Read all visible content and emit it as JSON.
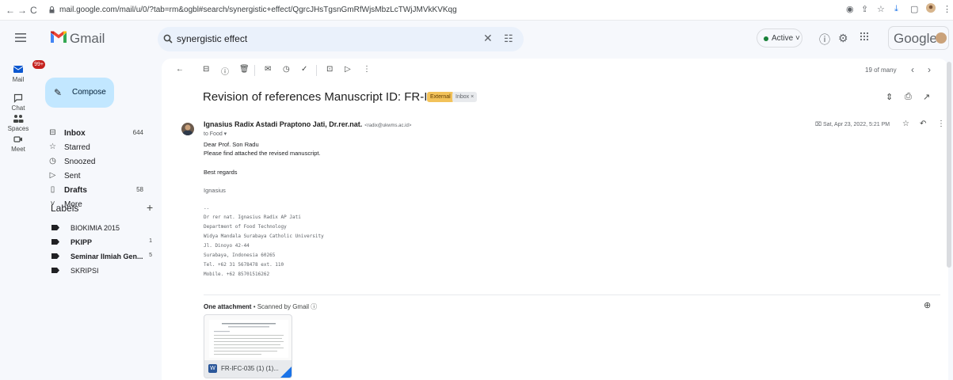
{
  "browser": {
    "url": "mail.google.com/mail/u/0/?tab=rm&ogbl#search/synergistic+effect/QgrcJHsTgsnGmRfWjsMbzLcTWjJMVkKVKqg"
  },
  "header": {
    "app_name": "Gmail",
    "search_value": "synergistic effect",
    "status_label": "Active",
    "brand": "Google"
  },
  "rail": {
    "items": [
      {
        "label": "Mail",
        "badge": "99+"
      },
      {
        "label": "Chat"
      },
      {
        "label": "Spaces"
      },
      {
        "label": "Meet"
      }
    ]
  },
  "sidebar": {
    "compose_label": "Compose",
    "items": [
      {
        "label": "Inbox",
        "count": "644",
        "bold": true
      },
      {
        "label": "Starred",
        "count": ""
      },
      {
        "label": "Snoozed",
        "count": ""
      },
      {
        "label": "Sent",
        "count": ""
      },
      {
        "label": "Drafts",
        "count": "58",
        "bold": true
      },
      {
        "label": "More",
        "count": ""
      }
    ],
    "labels_heading": "Labels",
    "labels_add": "+",
    "labels": [
      {
        "label": "BIOKIMIA 2015",
        "count": ""
      },
      {
        "label": "PKIPP",
        "count": "1",
        "bold": true
      },
      {
        "label": "Seminar Ilmiah Gen...",
        "count": "5",
        "bold": true
      },
      {
        "label": "SKRIPSI",
        "count": ""
      }
    ]
  },
  "toolbar": {
    "pager": "19 of many"
  },
  "email": {
    "subject": "Revision of references Manuscript ID: FR-IFC-035",
    "badge_external": "External",
    "badge_inbox": "Inbox ×",
    "sender_name": "Ignasius Radix Astadi Praptono Jati, Dr.rer.nat.",
    "sender_email": "<radix@ukwms.ac.id>",
    "to_line": "to Food ▾",
    "date": "Sat, Apr 23, 2022, 5:21 PM",
    "body": [
      "Dear Prof. Son Radu",
      "Please find attached the revised manuscript.",
      "Best regards",
      "Ignasius"
    ],
    "signature": [
      "--",
      "Dr rer nat. Ignasius Radix AP Jati",
      "Department of Food Technology",
      "Widya Mandala Surabaya Catholic University",
      "Jl. Dinoyo 42-44",
      "Surabaya, Indonesia 60265",
      "Tel. +62 31 5678478 ext. 110",
      "Mobile. +62 85701516262"
    ],
    "attachment_header_bold": "One attachment",
    "attachment_header_rest": " • Scanned by Gmail ⓘ",
    "attachment_name": "FR-IFC-035 (1) (1)..."
  }
}
